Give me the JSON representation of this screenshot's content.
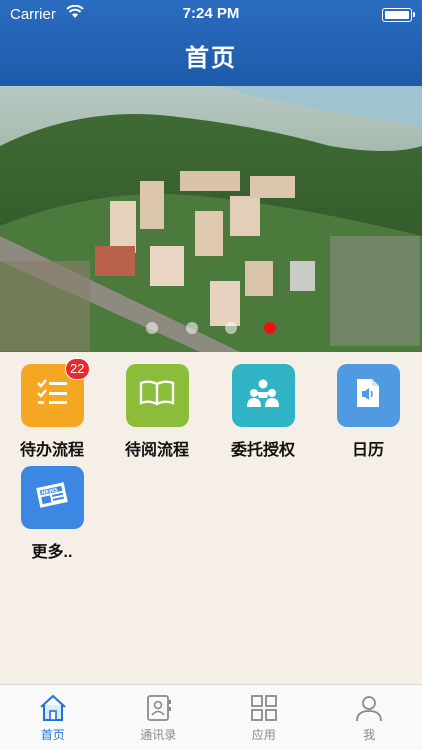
{
  "status_bar": {
    "carrier": "Carrier",
    "time": "7:24 PM"
  },
  "header": {
    "title": "首页"
  },
  "banner": {
    "slide_count": 4,
    "active_slide": 4
  },
  "apps": [
    {
      "label": "待办流程",
      "icon": "task-list-icon",
      "color": "#f5a623",
      "badge": "22"
    },
    {
      "label": "待阅流程",
      "icon": "open-book-icon",
      "color": "#8cbd3a",
      "badge": ""
    },
    {
      "label": "委托授权",
      "icon": "people-icon",
      "color": "#2fb3c5",
      "badge": ""
    },
    {
      "label": "日历",
      "icon": "audio-file-icon",
      "color": "#4f9ae0",
      "badge": ""
    },
    {
      "label": "更多..",
      "icon": "newspaper-icon",
      "color": "#3b87e2",
      "badge": ""
    }
  ],
  "tabbar": [
    {
      "label": "首页",
      "icon": "home-icon",
      "active": true
    },
    {
      "label": "通讯录",
      "icon": "contacts-icon",
      "active": false
    },
    {
      "label": "应用",
      "icon": "apps-grid-icon",
      "active": false
    },
    {
      "label": "我",
      "icon": "person-icon",
      "active": false
    }
  ]
}
